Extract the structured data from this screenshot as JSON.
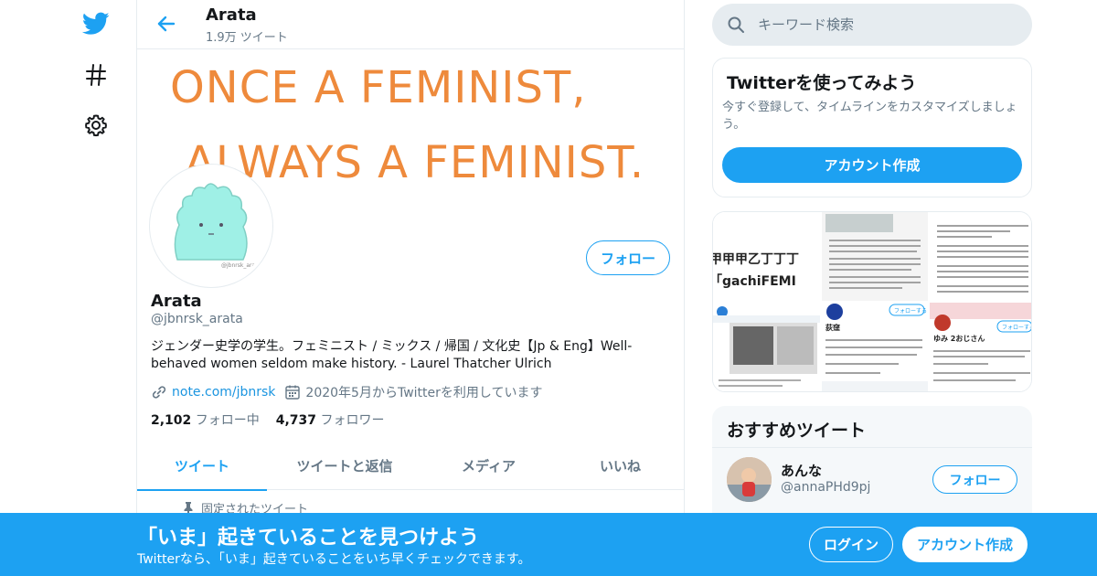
{
  "nav": {
    "items": [
      {
        "icon": "twitter-bird-icon"
      },
      {
        "icon": "hashtag-icon"
      },
      {
        "icon": "gear-icon"
      }
    ]
  },
  "header": {
    "name": "Arata",
    "tweet_count": "1.9万 ツイート"
  },
  "banner": {
    "line1": "ONCE A FEMINIST,",
    "line2": "ALWAYS A FEMINIST.",
    "color": "#ee8a3c"
  },
  "avatar": {
    "watermark": "@jbnrsk_arata",
    "color": "#9ff0e6"
  },
  "profile": {
    "follow_label": "フォロー",
    "name": "Arata",
    "handle": "@jbnrsk_arata",
    "bio": "ジェンダー史学の学生。フェミニスト / ミックス / 帰国 / 文化史【Jp & Eng】Well-behaved women seldom make history. - Laurel Thatcher Ulrich",
    "link": "note.com/jbnrsk",
    "joined": "2020年5月からTwitterを利用しています",
    "following_count": "2,102",
    "following_label": "フォロー中",
    "followers_count": "4,737",
    "followers_label": "フォロワー"
  },
  "tabs": [
    {
      "label": "ツイート",
      "active": true
    },
    {
      "label": "ツイートと返信",
      "active": false
    },
    {
      "label": "メディア",
      "active": false
    },
    {
      "label": "いいね",
      "active": false
    }
  ],
  "pinned_label": "固定されたツイート",
  "search": {
    "placeholder": "キーワード検索"
  },
  "signup_card": {
    "title": "Twitterを使ってみよう",
    "description": "今すぐ登録して、タイムラインをカスタマイズしましょう。",
    "button": "アカウント作成"
  },
  "media_grid": {
    "thumb1_text": "甲甲甲乙丁丁丁",
    "thumb1_text2": "「gachiFEMI",
    "thumb4_name": "荻窪",
    "thumb6_name": "ゆみ 2おじさん",
    "follow_tag": "フォローする"
  },
  "recommended": {
    "title": "おすすめツイート",
    "user_name": "あんな",
    "user_handle": "@annaPHd9pj",
    "follow_label": "フォロー"
  },
  "bottom_bar": {
    "title": "「いま」起きていることを見つけよう",
    "subtitle": "Twitterなら、「いま」起きていることをいち早くチェックできます。",
    "login": "ログイン",
    "signup": "アカウント作成",
    "color": "#1da1f2"
  }
}
